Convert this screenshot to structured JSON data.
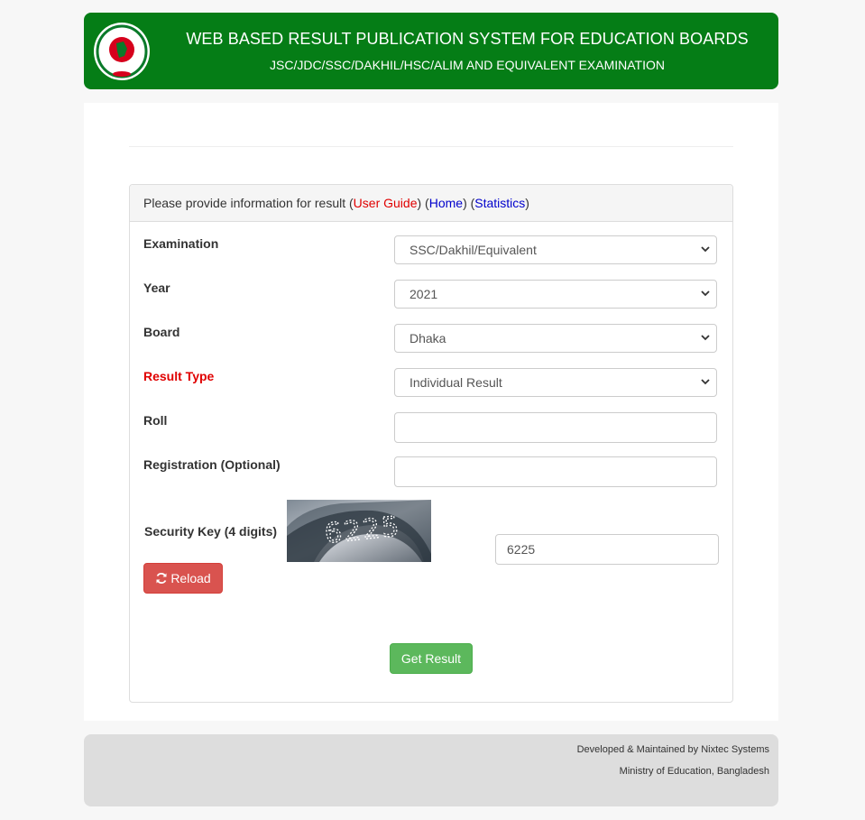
{
  "header": {
    "title": "WEB BASED RESULT PUBLICATION SYSTEM FOR EDUCATION BOARDS",
    "subtitle": "JSC/JDC/SSC/DAKHIL/HSC/ALIM AND EQUIVALENT EXAMINATION",
    "logo_icon": "bangladesh-government-seal"
  },
  "panel": {
    "heading_prefix": "Please provide information for result (",
    "user_guide": "User Guide",
    "sep1": ") (",
    "home": "Home",
    "sep2": ") (",
    "statistics": "Statistics",
    "heading_suffix": ")"
  },
  "form": {
    "examination_label": "Examination",
    "examination_value": "SSC/Dakhil/Equivalent",
    "year_label": "Year",
    "year_value": "2021",
    "board_label": "Board",
    "board_value": "Dhaka",
    "result_type_label": "Result Type",
    "result_type_value": "Individual Result",
    "roll_label": "Roll",
    "roll_value": "",
    "registration_label": "Registration (Optional)",
    "registration_value": "",
    "security_key_label": "Security Key (4 digits)",
    "security_key_value": "6225",
    "reload_label": "Reload",
    "submit_label": "Get Result"
  },
  "footer": {
    "line1": "Developed & Maintained by Nixtec Systems",
    "line2": "Ministry of Education, Bangladesh"
  },
  "colors": {
    "header_green": "#057d16",
    "result_type_red": "#e00000",
    "reload_red": "#d9534f",
    "submit_green": "#5cb85c"
  }
}
